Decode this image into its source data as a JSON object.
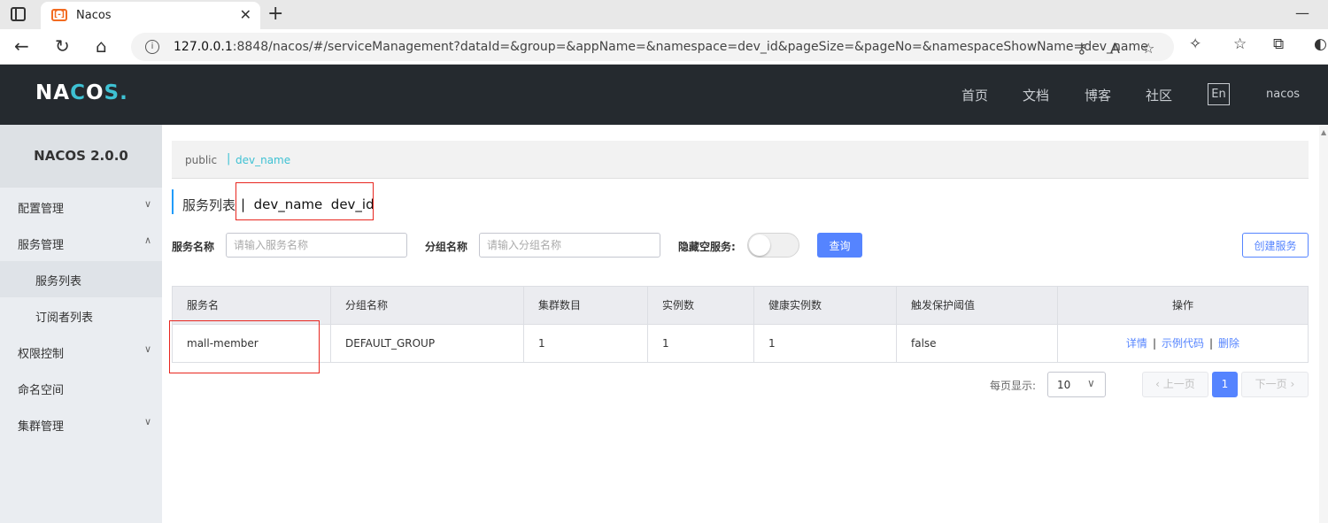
{
  "browser": {
    "tab_title": "Nacos",
    "tab_favicon": "[-]",
    "url_host": "127.0.0.1",
    "url_rest": ":8848/nacos/#/serviceManagement?dataId=&group=&appName=&namespace=dev_id&pageSize=&pageNo=&namespaceShowName=dev_name"
  },
  "header": {
    "logo": [
      "NA",
      "C",
      "O",
      "S."
    ],
    "nav": [
      "首页",
      "文档",
      "博客",
      "社区"
    ],
    "lang": "En",
    "user": "nacos"
  },
  "sidebar": {
    "title": "NACOS 2.0.0",
    "items": [
      {
        "label": "配置管理"
      },
      {
        "label": "服务管理"
      },
      {
        "label": "服务列表"
      },
      {
        "label": "订阅者列表"
      },
      {
        "label": "权限控制"
      },
      {
        "label": "命名空间"
      },
      {
        "label": "集群管理"
      }
    ]
  },
  "breadcrumb": {
    "public": "public",
    "sep": "|",
    "current": "dev_name"
  },
  "page": {
    "title": "服务列表",
    "namespace_info": "|  dev_name  dev_id"
  },
  "filters": {
    "service_label": "服务名称",
    "service_placeholder": "请输入服务名称",
    "group_label": "分组名称",
    "group_placeholder": "请输入分组名称",
    "hide_empty_label": "隐藏空服务:",
    "hide_empty_on": false,
    "query_button": "查询",
    "create_button": "创建服务"
  },
  "table": {
    "columns": [
      "服务名",
      "分组名称",
      "集群数目",
      "实例数",
      "健康实例数",
      "触发保护阈值",
      "操作"
    ],
    "rows": [
      {
        "service": "mall-member",
        "group": "DEFAULT_GROUP",
        "clusters": "1",
        "instances": "1",
        "healthy": "1",
        "threshold": "false",
        "actions": [
          "详情",
          "示例代码",
          "删除"
        ]
      }
    ]
  },
  "pagination": {
    "per_page_label": "每页显示:",
    "page_size": "10",
    "prev": "上一页",
    "current": "1",
    "next": "下一页"
  },
  "colors": {
    "primary": "#5584ff",
    "header_bg": "#252a2f",
    "accent": "#3ec1d3",
    "annotation": "#e8261f"
  }
}
